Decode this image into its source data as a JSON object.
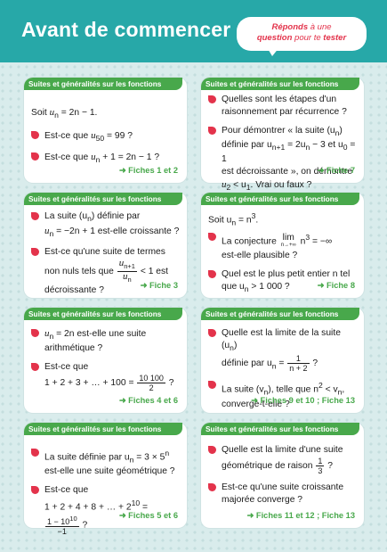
{
  "header": {
    "title": "Avant de commencer",
    "bubble_w1": "Réponds",
    "bubble_w2": " à une",
    "bubble_w3": "question",
    "bubble_w4": " pour te ",
    "bubble_w5": "tester"
  },
  "colors": {
    "header_bg": "#27a8a8",
    "tag_green": "#48a84b",
    "bullet_red": "#e3334b",
    "page_bg": "#d9ecec"
  },
  "tag": "Suites et généralités sur les fonctions",
  "cards": [
    {
      "ref": "➜ Fiches 1 et 2",
      "l1a": "Soit ",
      "l1b": "u",
      "l1c": "n",
      "l1d": " = 2n − 1.",
      "q1a": "Est-ce que ",
      "q1b": "u",
      "q1c": "50",
      "q1d": " = 99 ?",
      "q2a": "Est-ce que ",
      "q2b": "u",
      "q2c": "n",
      "q2d": " + 1 = 2n − 1 ?"
    },
    {
      "ref": "➜ Fiche 7",
      "q1": "Quelles sont les étapes d'un raisonnement par récurrence ?",
      "q2a": "Pour démontrer « la suite (u",
      "q2b": "n",
      "q2c": ")",
      "q2d": "définie par u",
      "q2e": "n+1",
      "q2f": " = 2u",
      "q2g": "n",
      "q2h": " − 3 et u",
      "q2i": "0",
      "q2j": " = 1",
      "q2k": "est décroissante », on démontre",
      "q2l": "u",
      "q2m": "2",
      "q2n": " < u",
      "q2o": "1",
      "q2p": ". Vrai ou faux ?"
    },
    {
      "ref": "➜ Fiche 3",
      "q1a": "La suite (u",
      "q1b": "n",
      "q1c": ") définie par",
      "q1d": "u",
      "q1e": "n",
      "q1f": " = −2n + 1 est-elle croissante ?",
      "q2a": "Est-ce qu'une suite de termes",
      "q2b": "non nuls tels que ",
      "fnum_a": "u",
      "fnum_b": "n+1",
      "fden_a": "u",
      "fden_b": "n",
      "q2c": " < 1 est",
      "q2d": "décroissante ?"
    },
    {
      "ref": "➜ Fiche 8",
      "l1a": "Soit u",
      "l1b": "n",
      "l1c": " = n",
      "l1d": "3",
      "l1e": ".",
      "q1a": "La conjecture ",
      "lim": "lim",
      "lim_sub": "n→+∞",
      "q1b": " n",
      "q1c": "3",
      "q1d": " = −∞",
      "q1e": "est-elle plausible ?",
      "q2": "Quel est le plus petit entier n tel que u",
      "q2b": "n",
      "q2c": " > 1 000 ?"
    },
    {
      "ref": "➜ Fiches 4 et 6",
      "q1a": "u",
      "q1b": "n",
      "q1c": " = 2n est-elle une suite",
      "q1d": "arithmétique ?",
      "q2a": "Est-ce que",
      "q2b": "1 + 2 + 3 + … + 100 = ",
      "fnum": "10 100",
      "fden": "2",
      "q2c": " ?"
    },
    {
      "ref": "➜ Fiches 9 et 10 ; Fiche 13",
      "q1a": "Quelle est la limite de la suite (u",
      "q1b": "n",
      "q1c": ")",
      "q1d": "définie par u",
      "q1e": "n",
      "q1f": " = ",
      "fnum": "1",
      "fden": "n + 2",
      "q1g": " ?",
      "q2a": "La suite (v",
      "q2b": "n",
      "q2c": "), telle que n",
      "q2d": "2",
      "q2e": " < v",
      "q2f": "n",
      "q2g": ",",
      "q2h": "converge-t-elle ?"
    },
    {
      "ref": "➜ Fiches 5 et 6",
      "q1a": "La suite définie par u",
      "q1b": "n",
      "q1c": " = 3 × 5",
      "q1d": "n",
      "q1e": "est-elle une suite géométrique ?",
      "q2a": "Est-ce que",
      "q2b": "1 + 2 + 4 + 8 + … + 2",
      "q2c": "10",
      "q2d": " = ",
      "fnum": "1 − 10",
      "fnum_sup": "10",
      "fden": "−1",
      "q2e": " ?"
    },
    {
      "ref": "➜ Fiches 11 et 12 ; Fiche 13",
      "q1a": "Quelle est la limite d'une suite",
      "q1b": "géométrique de raison ",
      "fnum": "1",
      "fden": "3",
      "q1c": " ?",
      "q2": "Est-ce qu'une suite croissante majorée converge ?"
    }
  ]
}
